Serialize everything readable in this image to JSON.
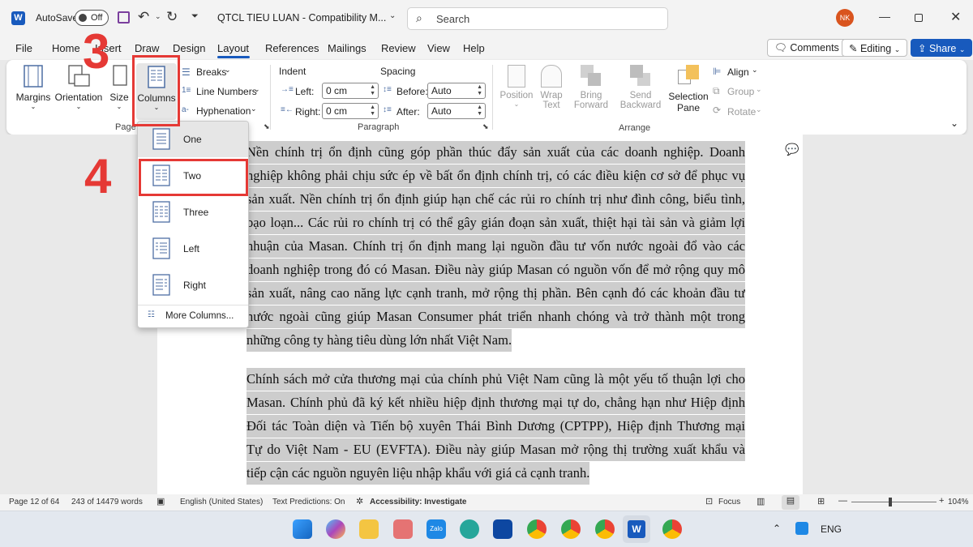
{
  "titlebar": {
    "autosave_label": "AutoSave",
    "autosave_state": "Off",
    "document_title": "QTCL TIEU LUAN - Compatibility M...",
    "search_placeholder": "Search",
    "avatar_initials": "NK"
  },
  "tabs": [
    "File",
    "Home",
    "Insert",
    "Draw",
    "Design",
    "Layout",
    "References",
    "Mailings",
    "Review",
    "View",
    "Help"
  ],
  "active_tab": "Layout",
  "topright": {
    "comments": "Comments",
    "editing": "Editing",
    "share": "Share"
  },
  "ribbon": {
    "page_setup": {
      "margins": "Margins",
      "orientation": "Orientation",
      "size": "Size",
      "columns": "Columns",
      "breaks": "Breaks",
      "line_numbers": "Line Numbers",
      "hyphenation": "Hyphenation",
      "group_label": "Page"
    },
    "paragraph": {
      "indent_title": "Indent",
      "spacing_title": "Spacing",
      "left_label": "Left:",
      "left_value": "0 cm",
      "right_label": "Right:",
      "right_value": "0 cm",
      "before_label": "Before:",
      "before_value": "Auto",
      "after_label": "After:",
      "after_value": "Auto",
      "group_label": "Paragraph"
    },
    "arrange": {
      "position": "Position",
      "wrap_text_1": "Wrap",
      "wrap_text_2": "Text",
      "bring_1": "Bring",
      "bring_2": "Forward",
      "send_1": "Send",
      "send_2": "Backward",
      "selection_1": "Selection",
      "selection_2": "Pane",
      "align": "Align",
      "group": "Group",
      "rotate": "Rotate",
      "group_label": "Arrange"
    }
  },
  "columns_menu": {
    "items": [
      "One",
      "Two",
      "Three",
      "Left",
      "Right"
    ],
    "more": "More Columns..."
  },
  "annotations": {
    "step3": "3",
    "step4": "4"
  },
  "document": {
    "para1_lines": [
      "Nền chính trị ổn định cũng góp phần thúc đẩy sản xuất của các doanh nghiệp. Doanh",
      "nghiệp không phải chịu sức ép về bất ổn định chính trị, có các điều kiện cơ sở để phục vụ",
      "sản xuất. Nền chính trị ổn định giúp hạn chế các rủi ro chính trị như đình công, biểu tình,",
      "bạo loạn... Các rủi ro chính trị có thể gây gián đoạn sản xuất, thiệt hại tài sản và giảm lợi",
      "nhuận của Masan. Chính trị ổn định mang lại nguồn đầu tư vốn nước ngoài đổ vào các",
      "doanh nghiệp trong đó có Masan. Điều này giúp Masan có nguồn vốn để mở rộng quy mô",
      "sản xuất, nâng cao năng lực cạnh tranh, mở rộng thị phần. Bên cạnh đó các khoản đầu tư",
      "nước ngoài cũng giúp Masan Consumer phát triển nhanh chóng và trở thành một trong",
      "những công ty hàng tiêu dùng lớn nhất Việt Nam."
    ],
    "para2_lines": [
      "Chính sách mở cửa thương mại của chính phủ Việt Nam cũng là một yếu tố thuận lợi cho",
      "Masan. Chính phủ đã ký kết nhiều hiệp định thương mại tự do, chẳng hạn như Hiệp định",
      "Đối tác Toàn diện và Tiến bộ xuyên Thái Bình Dương (CPTPP), Hiệp định Thương mại",
      "Tự do Việt Nam - EU (EVFTA). Điều này giúp Masan mở rộng thị trường xuất khẩu và",
      "tiếp cận các nguồn nguyên liệu nhập khẩu với giá cả cạnh tranh."
    ]
  },
  "statusbar": {
    "page": "Page 12 of 64",
    "words": "243 of 14479 words",
    "language": "English (United States)",
    "predictions": "Text Predictions: On",
    "accessibility": "Accessibility: Investigate",
    "focus": "Focus",
    "zoom": "104%"
  },
  "taskbar": {
    "language": "ENG"
  },
  "colors": {
    "accent": "#185abd",
    "annotation_red": "#e53935",
    "selection": "#cdcdcd"
  }
}
